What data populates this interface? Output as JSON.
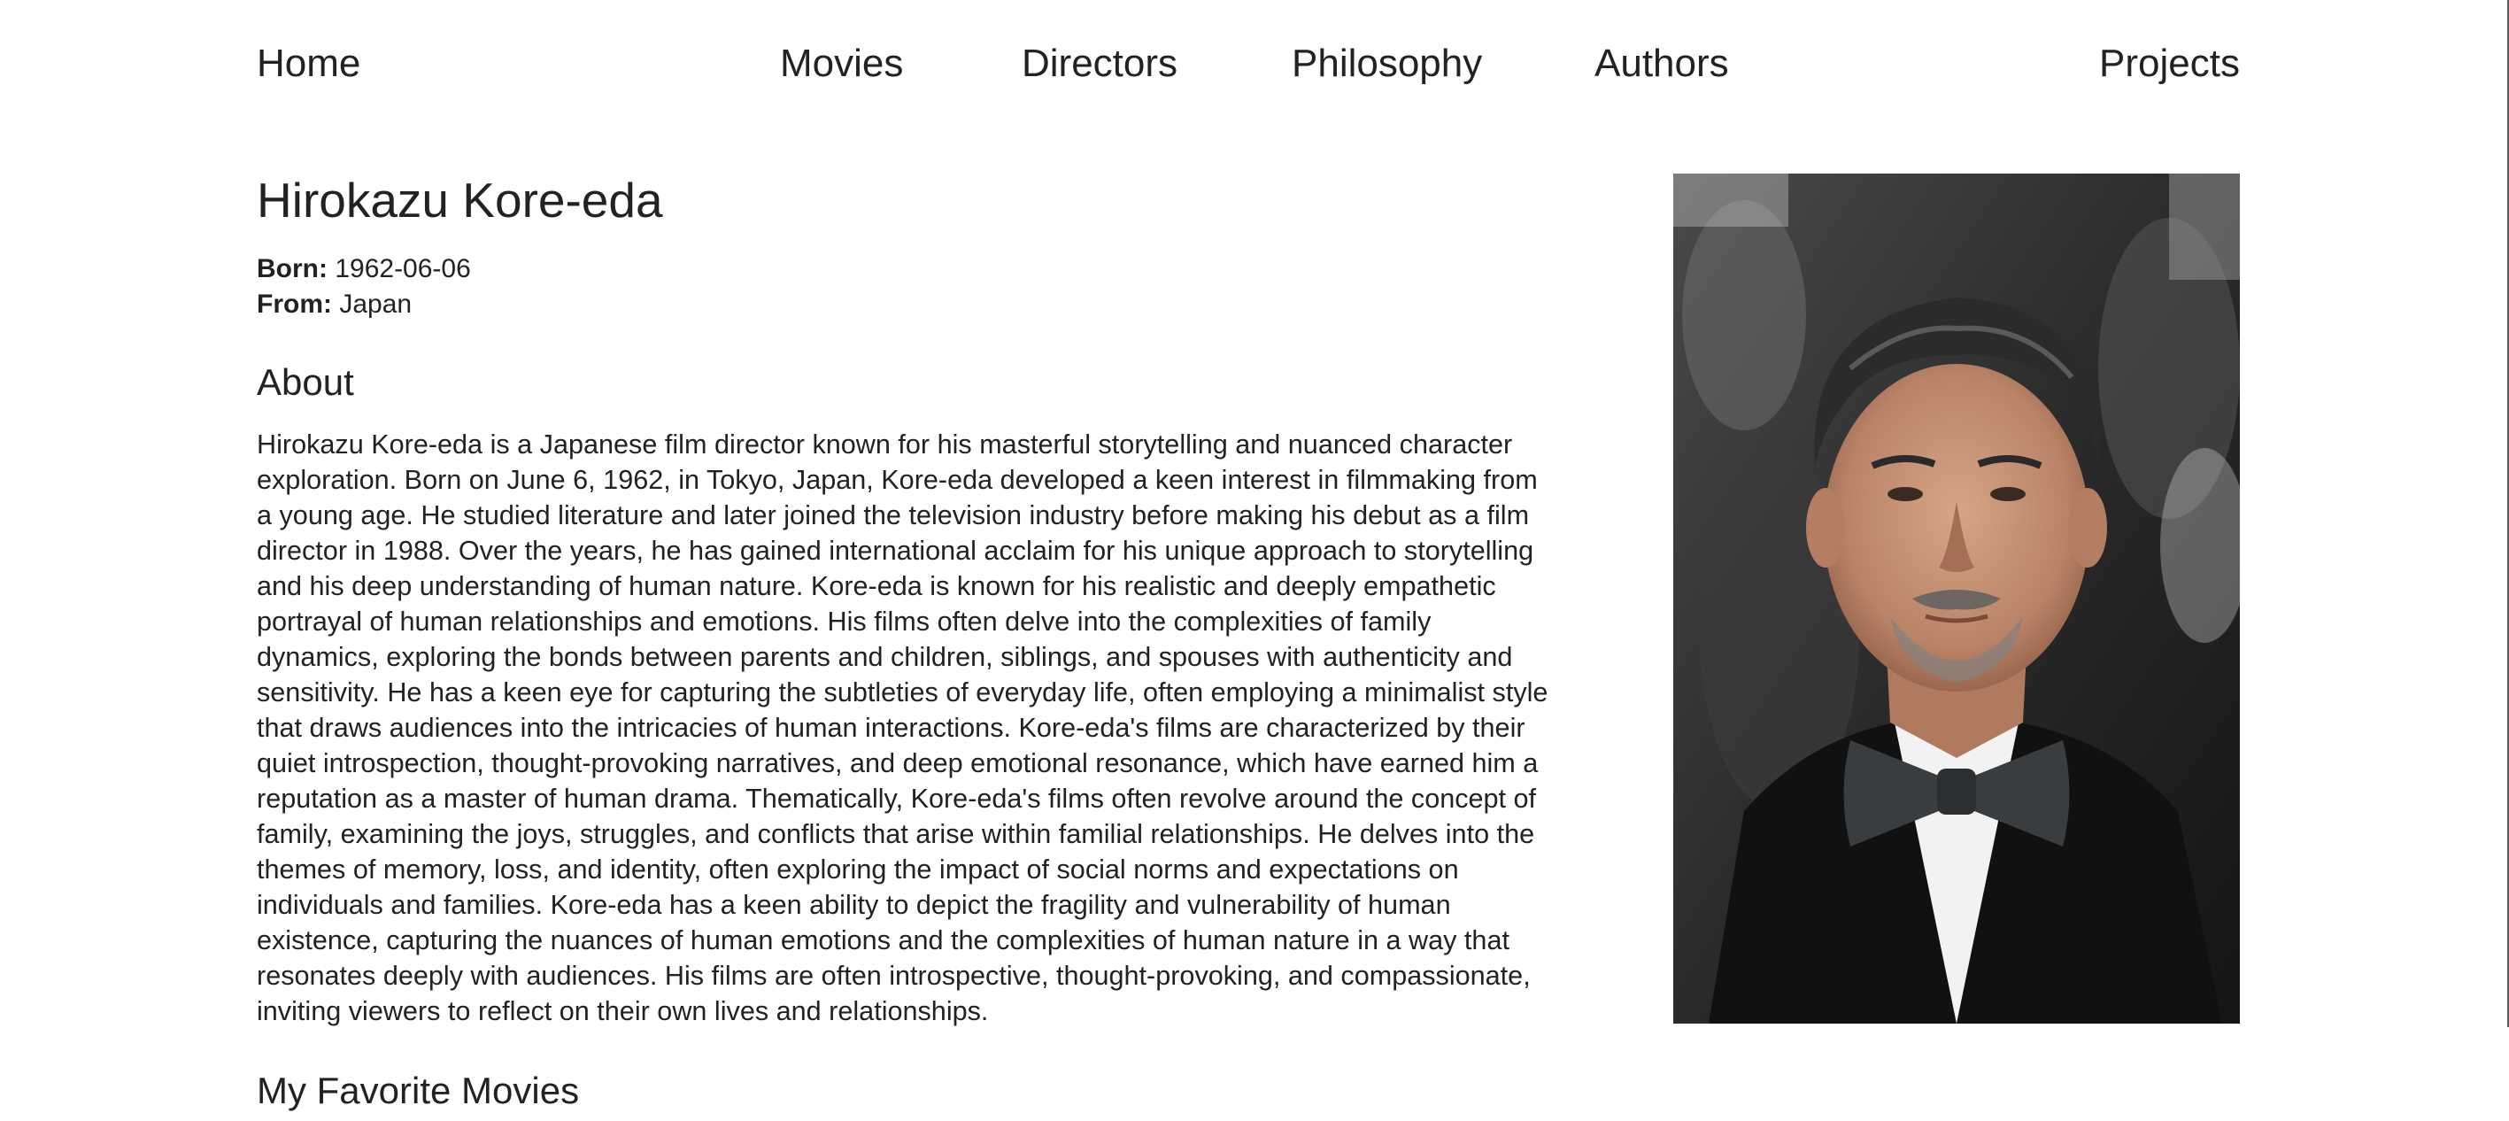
{
  "nav": {
    "home": "Home",
    "movies": "Movies",
    "directors": "Directors",
    "philosophy": "Philosophy",
    "authors": "Authors",
    "projects": "Projects"
  },
  "person": {
    "name": "Hirokazu Kore-eda",
    "born_label": "Born:",
    "born_value": "1962-06-06",
    "from_label": "From:",
    "from_value": "Japan"
  },
  "about": {
    "title": "About",
    "text": "Hirokazu Kore-eda is a Japanese film director known for his masterful storytelling and nuanced character exploration. Born on June 6, 1962, in Tokyo, Japan, Kore-eda developed a keen interest in filmmaking from a young age. He studied literature and later joined the television industry before making his debut as a film director in 1988. Over the years, he has gained international acclaim for his unique approach to storytelling and his deep understanding of human nature. Kore-eda is known for his realistic and deeply empathetic portrayal of human relationships and emotions. His films often delve into the complexities of family dynamics, exploring the bonds between parents and children, siblings, and spouses with authenticity and sensitivity. He has a keen eye for capturing the subtleties of everyday life, often employing a minimalist style that draws audiences into the intricacies of human interactions. Kore-eda's films are characterized by their quiet introspection, thought-provoking narratives, and deep emotional resonance, which have earned him a reputation as a master of human drama. Thematically, Kore-eda's films often revolve around the concept of family, examining the joys, struggles, and conflicts that arise within familial relationships. He delves into the themes of memory, loss, and identity, often exploring the impact of social norms and expectations on individuals and families. Kore-eda has a keen ability to depict the fragility and vulnerability of human existence, capturing the nuances of human emotions and the complexities of human nature in a way that resonates deeply with audiences. His films are often introspective, thought-provoking, and compassionate, inviting viewers to reflect on their own lives and relationships."
  },
  "movies_section": {
    "title": "My Favorite Movies"
  },
  "portrait": {
    "icon": "director-portrait-photo"
  }
}
